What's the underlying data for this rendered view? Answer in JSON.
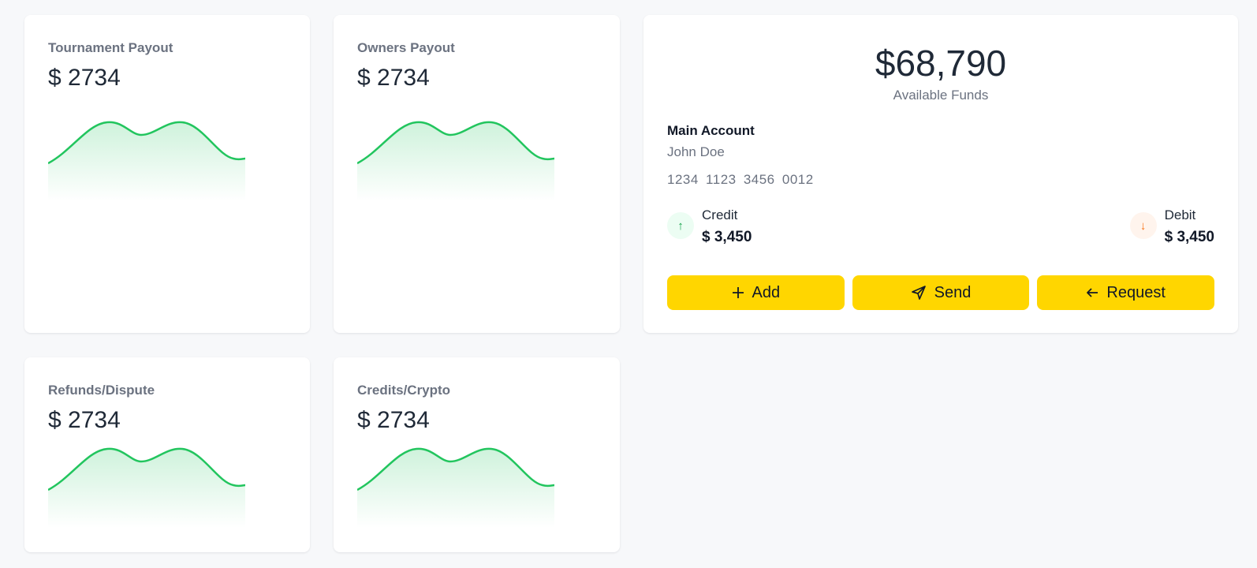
{
  "stats": [
    {
      "title": "Tournament Payout",
      "value": "$ 2734"
    },
    {
      "title": "Owners Payout",
      "value": "$ 2734"
    },
    {
      "title": "Refunds/Dispute",
      "value": "$ 2734"
    },
    {
      "title": "Credits/Crypto",
      "value": "$ 2734"
    }
  ],
  "wallet": {
    "total": "$68,790",
    "total_label": "Available Funds",
    "account_name": "Main Account",
    "account_holder": "John Doe",
    "account_number": "1234 1123 3456 0012",
    "credit": {
      "label": "Credit",
      "amount": "$ 3,450",
      "icon": "arrow-up-icon"
    },
    "debit": {
      "label": "Debit",
      "amount": "$ 3,450",
      "icon": "arrow-down-icon"
    },
    "actions": [
      {
        "label": "Add",
        "icon": "plus-icon"
      },
      {
        "label": "Send",
        "icon": "send-icon"
      },
      {
        "label": "Request",
        "icon": "arrow-left-icon"
      }
    ]
  },
  "colors": {
    "accent": "#ffd600",
    "spark_line": "#22c55e",
    "credit": "#16a34a",
    "debit": "#f97316"
  }
}
